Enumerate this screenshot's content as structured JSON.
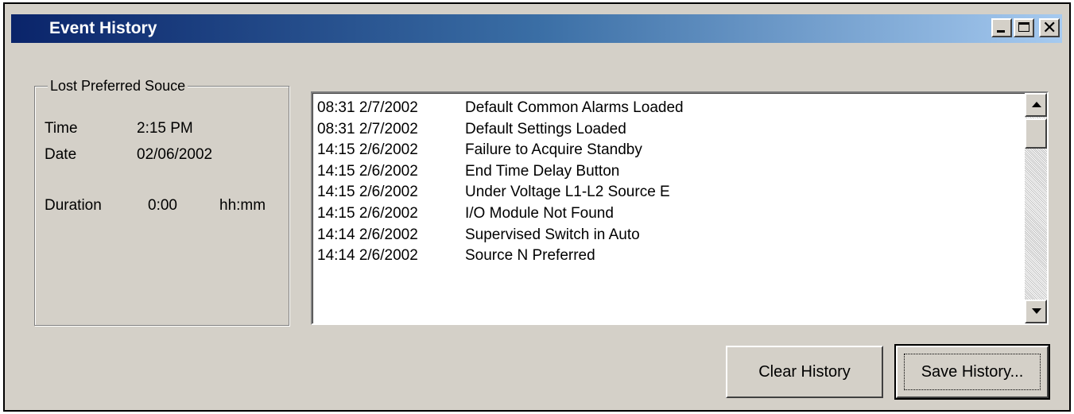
{
  "window": {
    "title": "Event History",
    "caption_buttons": [
      {
        "name": "minimize",
        "icon": "minimize-icon"
      },
      {
        "name": "maximize",
        "icon": "maximize-icon"
      },
      {
        "name": "close",
        "icon": "close-icon",
        "glyph": "✕"
      }
    ]
  },
  "details": {
    "group_label": "Lost Preferred Souce",
    "time_label": "Time",
    "time_value": "2:15 PM",
    "date_label": "Date",
    "date_value": "02/06/2002",
    "duration_label": "Duration",
    "duration_value": "0:00",
    "duration_unit": "hh:mm"
  },
  "history": {
    "rows": [
      {
        "timestamp": "08:31 2/7/2002",
        "event": "Default Common Alarms Loaded"
      },
      {
        "timestamp": "08:31 2/7/2002",
        "event": "Default Settings Loaded"
      },
      {
        "timestamp": "14:15 2/6/2002",
        "event": "Failure to Acquire Standby"
      },
      {
        "timestamp": "14:15 2/6/2002",
        "event": "End Time Delay Button"
      },
      {
        "timestamp": "14:15 2/6/2002",
        "event": "Under Voltage L1-L2 Source E"
      },
      {
        "timestamp": "14:15 2/6/2002",
        "event": "I/O Module Not Found"
      },
      {
        "timestamp": "14:14 2/6/2002",
        "event": "Supervised Switch in Auto"
      },
      {
        "timestamp": "14:14 2/6/2002",
        "event": "Source N Preferred"
      }
    ]
  },
  "buttons": {
    "clear_label": "Clear History",
    "save_label": "Save History..."
  },
  "colors": {
    "title_gradient_start": "#0a246a",
    "title_gradient_end": "#a6caf0",
    "face": "#d4d0c8"
  }
}
